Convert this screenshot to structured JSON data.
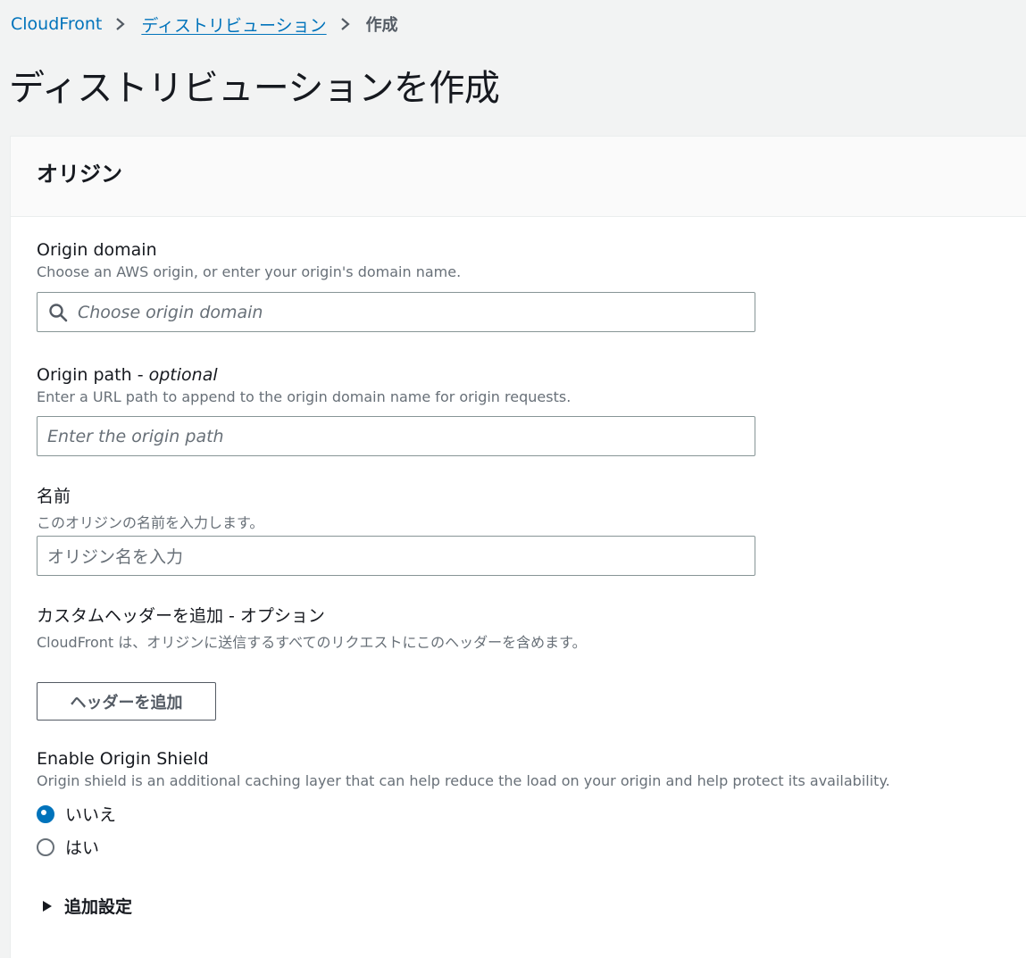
{
  "breadcrumb": {
    "root": "CloudFront",
    "parent": "ディストリビューション",
    "current": "作成"
  },
  "page": {
    "title": "ディストリビューションを作成"
  },
  "panel": {
    "title": "オリジン",
    "origin_domain": {
      "label": "Origin domain",
      "description": "Choose an AWS origin, or enter your origin's domain name.",
      "placeholder": "Choose origin domain"
    },
    "origin_path": {
      "label": "Origin path - ",
      "label_optional": "optional",
      "description": "Enter a URL path to append to the origin domain name for origin requests.",
      "placeholder": "Enter the origin path"
    },
    "name": {
      "label": "名前",
      "description": "このオリジンの名前を入力します。",
      "placeholder": "オリジン名を入力"
    },
    "custom_headers": {
      "label": "カスタムヘッダーを追加 - オプション",
      "description": "CloudFront は、オリジンに送信するすべてのリクエストにこのヘッダーを含めます。",
      "button": "ヘッダーを追加"
    },
    "origin_shield": {
      "label": "Enable Origin Shield",
      "description": "Origin shield is an additional caching layer that can help reduce the load on your origin and help protect its availability.",
      "options": [
        {
          "label": "いいえ",
          "selected": true
        },
        {
          "label": "はい",
          "selected": false
        }
      ]
    },
    "additional_settings": "追加設定"
  },
  "colors": {
    "link": "#0073bb",
    "radio_selected": "#0073bb"
  }
}
